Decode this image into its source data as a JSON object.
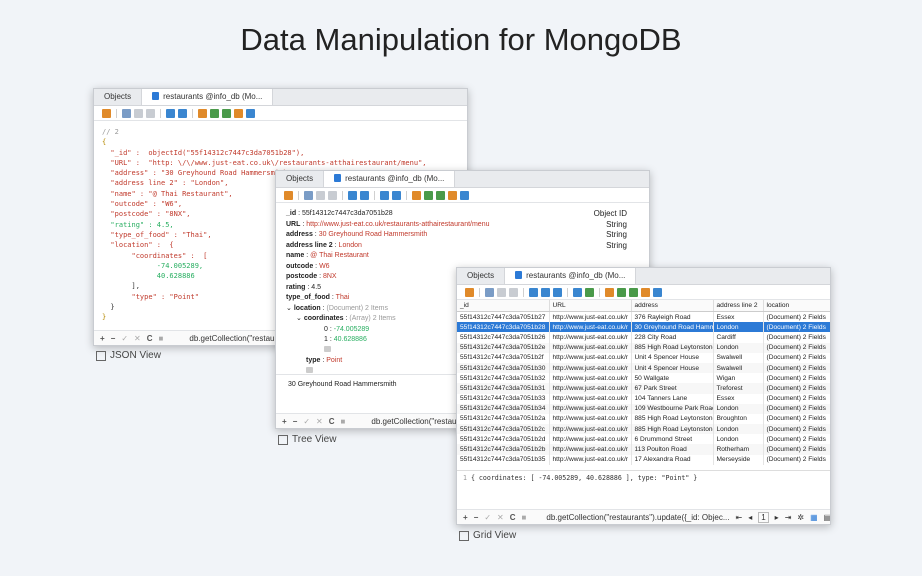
{
  "page_title": "Data Manipulation for MongoDB",
  "json_view": {
    "tabs": [
      "Objects",
      "restaurants @info_db (Mo..."
    ],
    "lines": {
      "comment": "// 2",
      "open": "{",
      "id_line": "  \"_id\" :  objectId(\"55f14312c7447c3da7051b28\"),",
      "url_line": "  \"URL\" :  \"http: \\/\\/www.just-eat.co.uk\\/restaurants-atthairestaurant/menu\",",
      "address_line": "  \"address\" : \"30 Greyhound Road Hammersmith\",",
      "address2_line": "  \"address line 2\" : \"London\",",
      "name_line": "  \"name\" : \"@ Thai Restaurant\",",
      "outcode_line": "  \"outcode\" : \"W6\",",
      "postcode_line": "  \"postcode\" : \"8NX\",",
      "rating_line": "  \"rating\" : 4.5,",
      "type_line": "  \"type_of_food\" : \"Thai\",",
      "location_line": "  \"location\" :  {",
      "coords_line": "       \"coordinates\" :  [",
      "lng_line": "             -74.005289,",
      "lat_line": "             40.628886",
      "close_arr": "       ],",
      "type_point": "       \"type\" : \"Point\"",
      "close_loc": "  }",
      "close": "}"
    },
    "status": "db.getCollection(\"restaurants\")",
    "caption": "JSON View"
  },
  "tree_view": {
    "tabs": [
      "Objects",
      "restaurants @info_db (Mo..."
    ],
    "rows": [
      {
        "key": "_id",
        "value": "55f14312c7447c3da7051b28",
        "type": "Object ID"
      },
      {
        "key": "URL",
        "value": "http://www.just-eat.co.uk/restaurants-atthairestaurant/menu",
        "type": "String"
      },
      {
        "key": "address",
        "value": "30 Greyhound Road Hammersmith",
        "type": "String"
      },
      {
        "key": "address line 2",
        "value": "London",
        "type": "String"
      },
      {
        "key": "name",
        "value": "@ Thai Restaurant",
        "type": ""
      },
      {
        "key": "outcode",
        "value": "W6",
        "type": ""
      },
      {
        "key": "postcode",
        "value": "8NX",
        "type": ""
      },
      {
        "key": "rating",
        "value": "4.5",
        "type": ""
      },
      {
        "key": "type_of_food",
        "value": "Thai",
        "type": ""
      }
    ],
    "location_key": "location",
    "location_meta": "(Document) 2 Items",
    "coords_key": "coordinates",
    "coords_meta": "(Array) 2 Items",
    "coord0_idx": "0",
    "coord0": "-74.005289",
    "coord1_idx": "1",
    "coord1": "40.628886",
    "type_key": "type",
    "type_val": "Point",
    "bottom_text": "30 Greyhound Road Hammersmith",
    "status": "db.getCollection(\"restaurants\"",
    "caption": "Tree View"
  },
  "grid_view": {
    "tabs": [
      "Objects",
      "restaurants @info_db (Mo..."
    ],
    "columns": [
      "_id",
      "URL",
      "address",
      "address line 2",
      "location"
    ],
    "rows": [
      [
        "55f14312c7447c3da7051b27",
        "http://www.just-eat.co.uk/r",
        "376 Rayleigh Road",
        "Essex",
        "(Document) 2 Fields"
      ],
      [
        "55f14312c7447c3da7051b28",
        "http://www.just-eat.co.uk/r",
        "30 Greyhound Road Hamm",
        "London",
        "(Document) 2 Fields"
      ],
      [
        "55f14312c7447c3da7051b26",
        "http://www.just-eat.co.uk/r",
        "228 City Road",
        "Cardiff",
        "(Document) 2 Fields"
      ],
      [
        "55f14312c7447c3da7051b2e",
        "http://www.just-eat.co.uk/r",
        "885 High Road Leytonstone",
        "London",
        "(Document) 2 Fields"
      ],
      [
        "55f14312c7447c3da7051b2f",
        "http://www.just-eat.co.uk/r",
        "Unit 4 Spencer House",
        "Swalwell",
        "(Document) 2 Fields"
      ],
      [
        "55f14312c7447c3da7051b30",
        "http://www.just-eat.co.uk/r",
        "Unit 4 Spencer House",
        "Swalwell",
        "(Document) 2 Fields"
      ],
      [
        "55f14312c7447c3da7051b32",
        "http://www.just-eat.co.uk/r",
        "50 Wallgate",
        "Wigan",
        "(Document) 2 Fields"
      ],
      [
        "55f14312c7447c3da7051b31",
        "http://www.just-eat.co.uk/r",
        "67 Park Street",
        "Treforest",
        "(Document) 2 Fields"
      ],
      [
        "55f14312c7447c3da7051b33",
        "http://www.just-eat.co.uk/r",
        "104 Tanners Lane",
        "Essex",
        "(Document) 2 Fields"
      ],
      [
        "55f14312c7447c3da7051b34",
        "http://www.just-eat.co.uk/r",
        "109 Westbourne Park Road",
        "London",
        "(Document) 2 Fields"
      ],
      [
        "55f14312c7447c3da7051b2a",
        "http://www.just-eat.co.uk/r",
        "885 High Road Leytonstone",
        "Broughton",
        "(Document) 2 Fields"
      ],
      [
        "55f14312c7447c3da7051b2c",
        "http://www.just-eat.co.uk/r",
        "885 High Road Leytonstone",
        "London",
        "(Document) 2 Fields"
      ],
      [
        "55f14312c7447c3da7051b2d",
        "http://www.just-eat.co.uk/r",
        "6 Drummond Street",
        "London",
        "(Document) 2 Fields"
      ],
      [
        "55f14312c7447c3da7051b2b",
        "http://www.just-eat.co.uk/r",
        "113 Poulton Road",
        "Rotherham",
        "(Document) 2 Fields"
      ],
      [
        "55f14312c7447c3da7051b35",
        "http://www.just-eat.co.uk/r",
        "17 Alexandra Road",
        "Merseyside",
        "(Document) 2 Fields"
      ]
    ],
    "selected_row": 1,
    "detail": "{  coordinates: [  -74.005289,  40.628886  ], type: \"Point\" }",
    "detail_line_no": "1",
    "status": "db.getCollection(\"restaurants\").update({_id: Objec...",
    "page_number": "1",
    "caption": "Grid View"
  },
  "colors": {
    "accent": "#2c7ad6",
    "string": "#c0392b",
    "number": "#27ae60"
  }
}
